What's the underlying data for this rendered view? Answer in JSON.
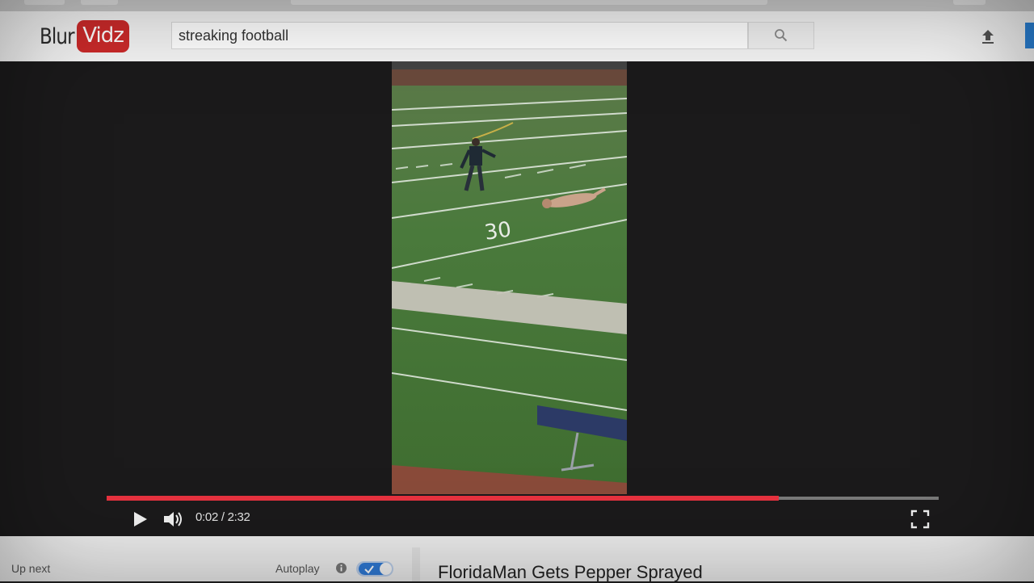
{
  "header": {
    "logo_part1": "Blur",
    "logo_part2": "Vidz",
    "search_value": "streaking football",
    "search_icon": "search-icon",
    "upload_icon": "upload-icon"
  },
  "player": {
    "time_display": "0:02 / 2:32",
    "progress_fraction": 0.808,
    "accent_color": "#e9323f",
    "field_number": "30",
    "icons": [
      "play-icon",
      "volume-icon",
      "fullscreen-icon"
    ]
  },
  "below": {
    "up_next_label": "Up next",
    "autoplay_label": "Autoplay",
    "autoplay_on": true,
    "next_video_title": "FloridaMan Gets Pepper Sprayed"
  }
}
